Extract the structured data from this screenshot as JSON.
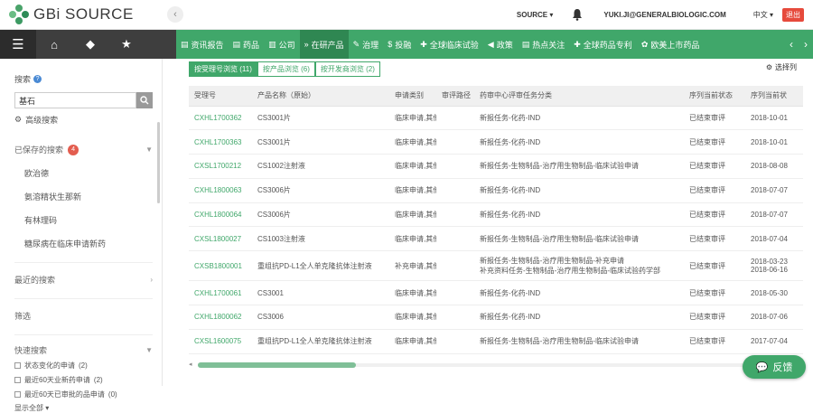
{
  "header": {
    "logo_text": "GBi SOURCE",
    "source_menu": "SOURCE ▾",
    "user": "YUKI.JI@GENERALBIOLOGIC.COM",
    "lang": "中文 ▾",
    "logout": "退出"
  },
  "nav": {
    "items": [
      {
        "label": "资讯报告",
        "icon": "▤"
      },
      {
        "label": "药品",
        "icon": "▤"
      },
      {
        "label": "公司",
        "icon": "▥"
      },
      {
        "label": "在研产品",
        "icon": "»"
      },
      {
        "label": "治理",
        "icon": "✎"
      },
      {
        "label": "投融",
        "icon": "$"
      },
      {
        "label": "全球临床试验",
        "icon": "✚"
      },
      {
        "label": "政策",
        "icon": "◀"
      },
      {
        "label": "热点关注",
        "icon": "▤"
      },
      {
        "label": "全球药品专利",
        "icon": "✚"
      },
      {
        "label": "欧美上市药品",
        "icon": "✿"
      }
    ],
    "active_index": 3
  },
  "sidebar": {
    "search_label": "搜索",
    "search_value": "基石",
    "advanced_search": "高级搜索",
    "saved_label": "已保存的搜索",
    "saved_count": "4",
    "saved_items": [
      "欧治德",
      "氨溶精状生那新",
      "有林理码",
      "糖尿病在临床申请新药"
    ],
    "recent_label": "最近的搜索",
    "filter_label": "筛选",
    "quick_label": "快速搜索",
    "quick_items": [
      {
        "label": "状态变化的申请",
        "count": "(2)"
      },
      {
        "label": "最近60天业新药申请",
        "count": "(2)"
      },
      {
        "label": "最近60天已审批的品申请",
        "count": "(0)"
      }
    ],
    "show_all": "显示全部 ▾"
  },
  "main": {
    "tabs": [
      "按受理号浏览 (11)",
      "按产品浏览 (6)",
      "按开发商浏览 (2)"
    ],
    "select_columns": "选择列",
    "columns": [
      "受理号",
      "产品名称（原始）",
      "申请类别",
      "审评路径",
      "药审中心评审任务分类",
      "序列当前状态",
      "序列当前状"
    ],
    "rows": [
      [
        "CXHL1700362",
        "CS3001片",
        "临床申请,其他",
        "",
        "新报任务-化药-IND",
        "已结束审评",
        "2018-10-01"
      ],
      [
        "CXHL1700363",
        "CS3001片",
        "临床申请,其他",
        "",
        "新报任务-化药-IND",
        "已结束审评",
        "2018-10-01"
      ],
      [
        "CXSL1700212",
        "CS1002注射液",
        "临床申请,其他",
        "",
        "新报任务-生物制品-治疗用生物制品-临床试验申请",
        "已结束审评",
        "2018-08-08"
      ],
      [
        "CXHL1800063",
        "CS3006片",
        "临床申请,其他",
        "",
        "新报任务-化药-IND",
        "已结束审评",
        "2018-07-07"
      ],
      [
        "CXHL1800064",
        "CS3006片",
        "临床申请,其他",
        "",
        "新报任务-化药-IND",
        "已结束审评",
        "2018-07-07"
      ],
      [
        "CXSL1800027",
        "CS1003注射液",
        "临床申请,其他",
        "",
        "新报任务-生物制品-治疗用生物制品-临床试验申请",
        "已结束审评",
        "2018-07-04"
      ],
      [
        "CXSB1800001",
        "重组抗PD-L1全人单克隆抗体注射液",
        "补充申请,其他",
        "",
        "新报任务-生物制品-治疗用生物制品-补充申请",
        "已结束审评",
        "2018-03-23"
      ],
      [
        "CXHL1700061",
        "CS3001",
        "临床申请,其他",
        "",
        "新报任务-化药-IND",
        "已结束审评",
        "2018-05-30"
      ],
      [
        "CXHL1800062",
        "CS3006",
        "临床申请,其他",
        "",
        "新报任务-化药-IND",
        "已结束审评",
        "2018-07-06"
      ],
      [
        "CXSL1600075",
        "重组抗PD-L1全人单克隆抗体注射液",
        "临床申请,其他",
        "",
        "新报任务-生物制品-治疗用生物制品-临床试验申请",
        "已结束审评",
        "2017-07-04"
      ]
    ],
    "row7_extra_task": "补充资料任务-生物制品-治疗用生物制品-临床试验药学部",
    "row7_extra_date": "2018-06-16"
  },
  "feedback": "反馈",
  "colors": {
    "brand_green": "#40a76a",
    "nav_dark": "#3e3e3e",
    "badge_red": "#e35d4f"
  },
  "icons": [
    "home-icon",
    "tag-icon",
    "star-icon",
    "menu-icon",
    "bell-icon",
    "search-icon",
    "gear-icon",
    "chevron-down-icon",
    "chevron-right-icon"
  ]
}
